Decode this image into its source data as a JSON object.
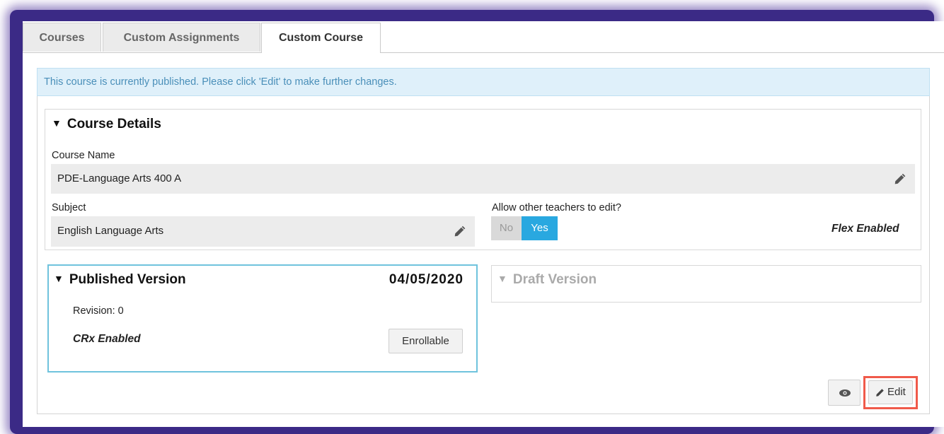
{
  "tabs": [
    {
      "label": "Courses"
    },
    {
      "label": "Custom Assignments"
    },
    {
      "label": "Custom Course"
    }
  ],
  "alert": {
    "text": "This course is currently published. Please click 'Edit' to make further changes."
  },
  "course_details": {
    "title": "Course Details",
    "course_name_label": "Course Name",
    "course_name_value": "PDE-Language Arts 400 A",
    "subject_label": "Subject",
    "subject_value": "English Language Arts",
    "allow_edit_label": "Allow other teachers to edit?",
    "toggle_no": "No",
    "toggle_yes": "Yes",
    "toggle_selected": "Yes",
    "flex_label": "Flex Enabled"
  },
  "published": {
    "title": "Published Version",
    "date": "04/05/2020",
    "revision": "Revision: 0",
    "crx": "CRx Enabled",
    "enroll_button": "Enrollable"
  },
  "draft": {
    "title": "Draft Version"
  },
  "actions": {
    "edit_label": "Edit"
  },
  "colors": {
    "accent": "#29a8e0",
    "alert_bg": "#dff0fa",
    "highlight": "#f05a4a",
    "frame": "#3b2a86"
  }
}
